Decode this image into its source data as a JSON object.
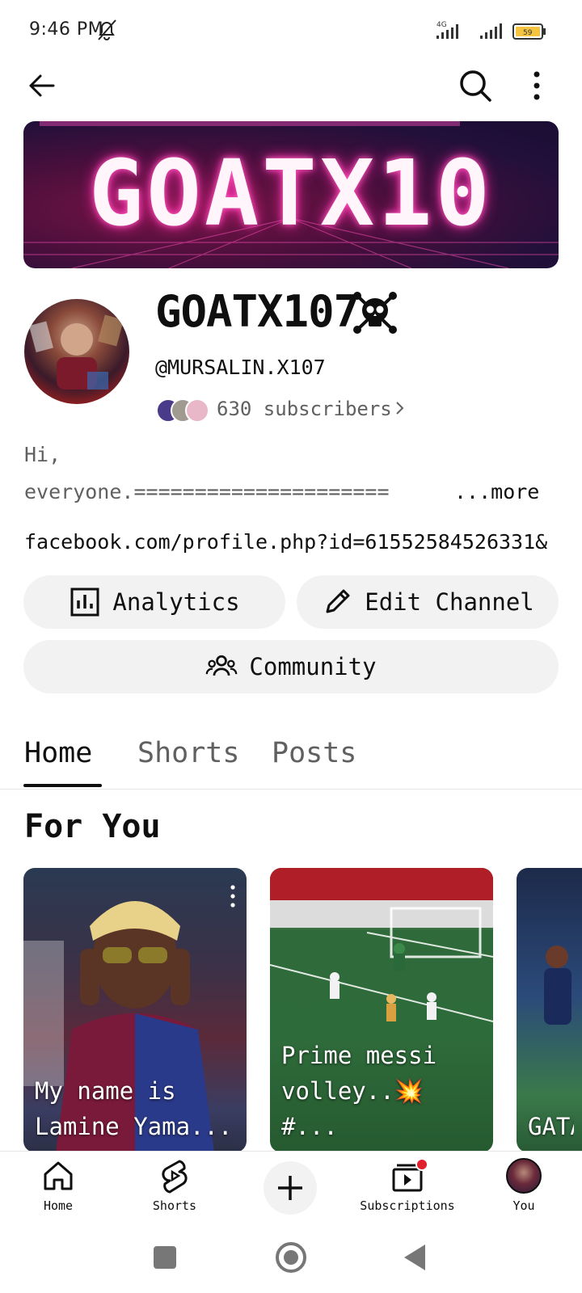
{
  "status_bar": {
    "time": "9:46 PM",
    "network": "4G",
    "battery": "59"
  },
  "top_bar": {
    "back_icon": "arrow-left-icon",
    "search_icon": "search-icon",
    "menu_icon": "more-vert-icon"
  },
  "banner": {
    "text": "GOATX10"
  },
  "channel": {
    "name": "GOATX107",
    "handle": "@MURSALIN.X107",
    "subscribers": "630 subscribers",
    "description_line1": "Hi,",
    "description_line2": "everyone.=====================",
    "more_label": "...more",
    "link": "facebook.com/profile.php?id=61552584526331&..."
  },
  "buttons": {
    "analytics": "Analytics",
    "edit_channel": "Edit Channel",
    "community": "Community"
  },
  "tabs": [
    {
      "label": "Home",
      "selected": true
    },
    {
      "label": "Shorts"
    },
    {
      "label": "Posts"
    }
  ],
  "section": {
    "title": "For You"
  },
  "cards": [
    {
      "title": "My name is Lamine Yama..."
    },
    {
      "title": "Prime messi volley..💥 #..."
    },
    {
      "title": "GATA ❤️X"
    }
  ],
  "bottom_nav": [
    {
      "label": "Home"
    },
    {
      "label": "Shorts"
    },
    {
      "label": "Subscriptions"
    },
    {
      "label": "You"
    }
  ],
  "colors": {
    "text": "#0f0f0f",
    "secondary_text": "#606060",
    "pill_bg": "#f2f2f2",
    "badge_red": "#e0202c"
  }
}
